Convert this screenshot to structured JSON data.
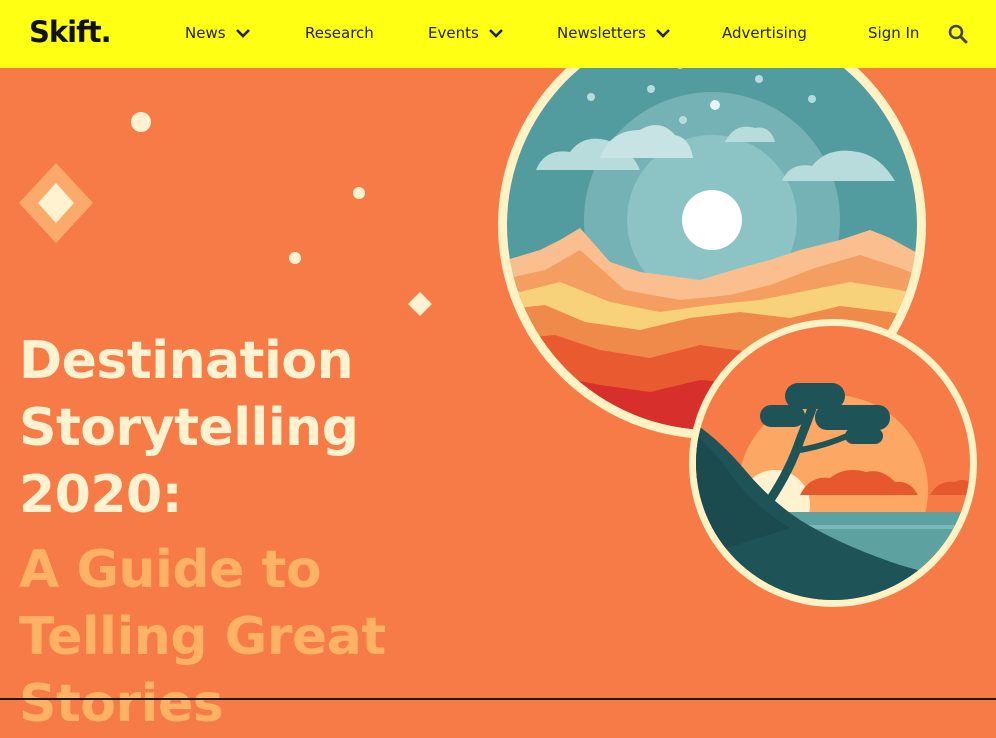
{
  "nav": {
    "logo": "Skift",
    "items": [
      {
        "label": "News",
        "has_dropdown": true
      },
      {
        "label": "Research",
        "has_dropdown": false
      },
      {
        "label": "Events",
        "has_dropdown": true
      },
      {
        "label": "Newsletters",
        "has_dropdown": true
      },
      {
        "label": "Advertising",
        "has_dropdown": false
      }
    ],
    "sign_in": "Sign In",
    "search_icon": "search-icon"
  },
  "hero": {
    "title_lines": [
      "Destination",
      "Storytelling",
      "2020:"
    ],
    "subtitle_lines": [
      "A Guide to",
      "Telling Great",
      "Stories"
    ]
  },
  "colors": {
    "nav_bg": "#ffff14",
    "hero_bg": "#f77b46",
    "title": "#fff2d1",
    "subtitle": "#ffb166",
    "ring": "#fff2c4",
    "teal_dark": "#1e5357"
  }
}
